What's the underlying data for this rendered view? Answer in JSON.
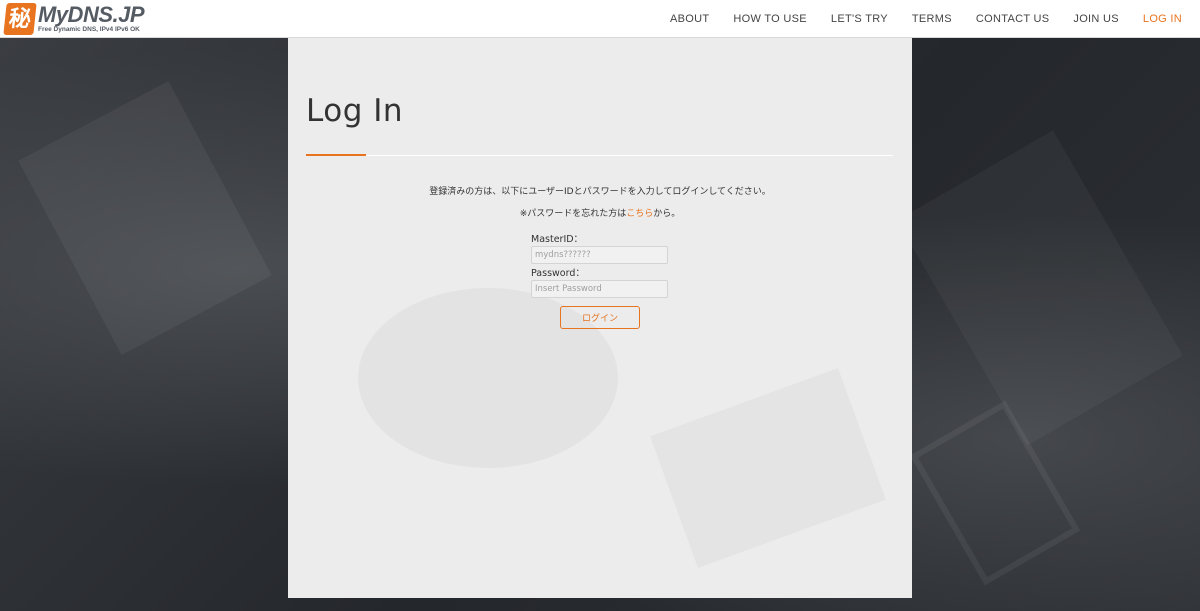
{
  "header": {
    "logo_mark": "秘",
    "logo_text": "MyDNS.JP",
    "logo_tagline": "Free Dynamic DNS, IPv4 IPv6 OK",
    "nav": [
      {
        "label": "ABOUT",
        "active": false
      },
      {
        "label": "HOW TO USE",
        "active": false
      },
      {
        "label": "LET'S TRY",
        "active": false
      },
      {
        "label": "TERMS",
        "active": false
      },
      {
        "label": "CONTACT US",
        "active": false
      },
      {
        "label": "JOIN US",
        "active": false
      },
      {
        "label": "LOG IN",
        "active": true
      }
    ]
  },
  "main": {
    "title": "Log In",
    "intro": "登録済みの方は、以下にユーザーIDとパスワードを入力してログインしてください。",
    "forgot_prefix": "※パスワードを忘れた方は",
    "forgot_link": "こちら",
    "forgot_suffix": "から。",
    "form": {
      "masterid_label": "MasterID：",
      "masterid_placeholder": "mydns??????",
      "password_label": "Password：",
      "password_placeholder": "Insert Password",
      "submit_label": "ログイン"
    }
  },
  "colors": {
    "accent": "#e8741f",
    "panel": "#ececec",
    "text": "#333333"
  }
}
